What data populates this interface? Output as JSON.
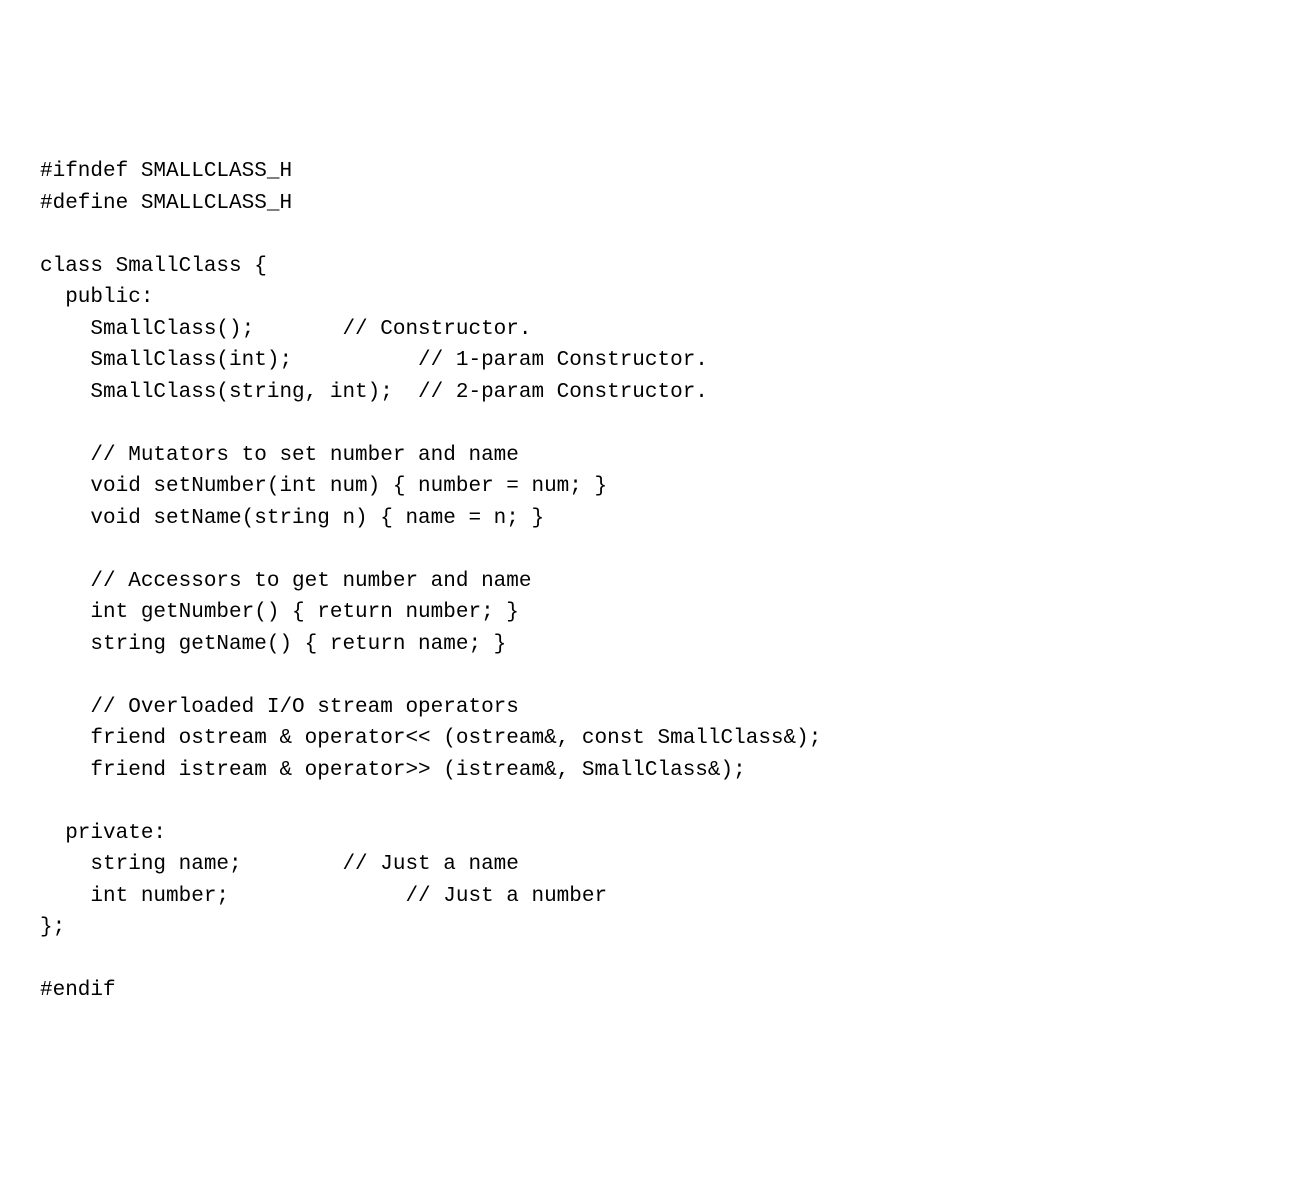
{
  "lines": [
    "#ifndef SMALLCLASS_H",
    "#define SMALLCLASS_H",
    "",
    "class SmallClass {",
    "  public:",
    "    SmallClass();       // Constructor.",
    "    SmallClass(int);          // 1-param Constructor.",
    "    SmallClass(string, int);  // 2-param Constructor.",
    "",
    "    // Mutators to set number and name",
    "    void setNumber(int num) { number = num; }",
    "    void setName(string n) { name = n; }",
    "",
    "    // Accessors to get number and name",
    "    int getNumber() { return number; }",
    "    string getName() { return name; }",
    "",
    "    // Overloaded I/O stream operators",
    "    friend ostream & operator<< (ostream&, const SmallClass&);",
    "    friend istream & operator>> (istream&, SmallClass&);",
    "",
    "  private:",
    "    string name;        // Just a name",
    "    int number;              // Just a number",
    "};",
    "",
    "#endif"
  ]
}
